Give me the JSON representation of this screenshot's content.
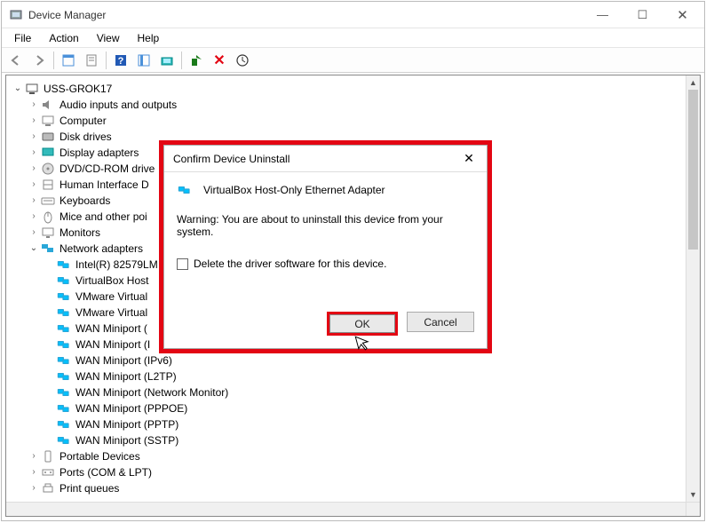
{
  "window": {
    "title": "Device Manager",
    "menu": [
      "File",
      "Action",
      "View",
      "Help"
    ],
    "buttons": {
      "min": "—",
      "max": "☐",
      "close": "✕"
    }
  },
  "tree": {
    "root": "USS-GROK17",
    "categories": [
      {
        "label": "Audio inputs and outputs",
        "icon": "speaker"
      },
      {
        "label": "Computer",
        "icon": "computer"
      },
      {
        "label": "Disk drives",
        "icon": "disk"
      },
      {
        "label": "Display adapters",
        "icon": "display"
      },
      {
        "label": "DVD/CD-ROM drive",
        "icon": "dvd"
      },
      {
        "label": "Human Interface D",
        "icon": "hid"
      },
      {
        "label": "Keyboards",
        "icon": "keyboard"
      },
      {
        "label": "Mice and other poi",
        "icon": "mouse"
      },
      {
        "label": "Monitors",
        "icon": "monitor"
      },
      {
        "label": "Network adapters",
        "icon": "network",
        "expanded": true,
        "children": [
          "Intel(R) 82579LM",
          "VirtualBox Host",
          "VMware Virtual",
          "VMware Virtual",
          "WAN Miniport (",
          "WAN Miniport (I",
          "WAN Miniport (IPv6)",
          "WAN Miniport (L2TP)",
          "WAN Miniport (Network Monitor)",
          "WAN Miniport (PPPOE)",
          "WAN Miniport (PPTP)",
          "WAN Miniport (SSTP)"
        ]
      },
      {
        "label": "Portable Devices",
        "icon": "portable"
      },
      {
        "label": "Ports (COM & LPT)",
        "icon": "ports"
      },
      {
        "label": "Print queues",
        "icon": "printer"
      }
    ]
  },
  "dialog": {
    "title": "Confirm Device Uninstall",
    "device": "VirtualBox Host-Only Ethernet Adapter",
    "warning": "Warning: You are about to uninstall this device from your system.",
    "checkbox": "Delete the driver software for this device.",
    "ok": "OK",
    "cancel": "Cancel"
  }
}
